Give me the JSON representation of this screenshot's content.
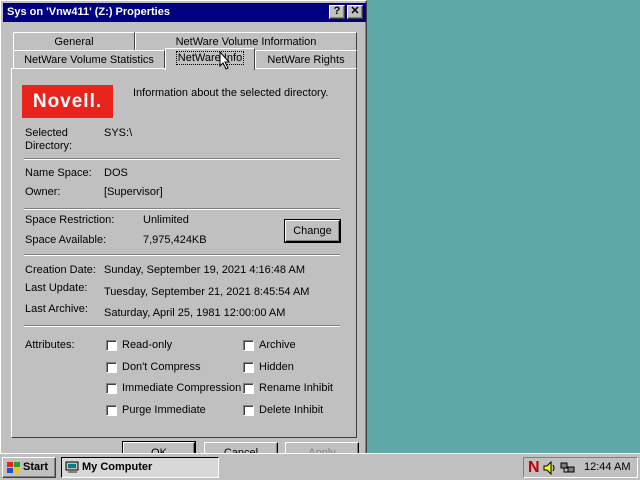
{
  "window": {
    "title": "Sys on 'Vnw411' (Z:) Properties",
    "help_btn": "?",
    "close_btn": "✕"
  },
  "tabs": {
    "row1": [
      "General",
      "NetWare Volume Information"
    ],
    "row2": [
      "NetWare Volume Statistics",
      "NetWare Info",
      "NetWare Rights"
    ],
    "active": "NetWare Info"
  },
  "info": {
    "logo": "Novell.",
    "description": "Information about the selected directory.",
    "selected_directory_label": "Selected Directory:",
    "selected_directory_value": "SYS:\\",
    "name_space_label": "Name Space:",
    "name_space_value": "DOS",
    "owner_label": "Owner:",
    "owner_value": "[Supervisor]",
    "space_restriction_label": "Space Restriction:",
    "space_restriction_value": "Unlimited",
    "space_available_label": "Space Available:",
    "space_available_value": "7,975,424KB",
    "change_button": "Change",
    "creation_date_label": "Creation Date:",
    "creation_date_value": "Sunday, September 19, 2021 4:16:48 AM",
    "last_update_label": "Last Update:",
    "last_update_value": "Tuesday, September 21, 2021 8:45:54 AM",
    "last_archive_label": "Last Archive:",
    "last_archive_value": "Saturday, April 25, 1981 12:00:00 AM",
    "attributes_label": "Attributes:",
    "attributes": [
      {
        "label": "Read-only",
        "checked": false
      },
      {
        "label": "Don't Compress",
        "checked": false
      },
      {
        "label": "Immediate Compression",
        "checked": false
      },
      {
        "label": "Purge Immediate",
        "checked": false
      },
      {
        "label": "Archive",
        "checked": false
      },
      {
        "label": "Hidden",
        "checked": false
      },
      {
        "label": "Rename Inhibit",
        "checked": false
      },
      {
        "label": "Delete Inhibit",
        "checked": false
      }
    ]
  },
  "buttons": {
    "ok": "OK",
    "cancel": "Cancel",
    "apply": "Apply"
  },
  "taskbar": {
    "start": "Start",
    "task": "My Computer",
    "clock": "12:44 AM"
  },
  "colors": {
    "desktop": "#5fa8a8",
    "titlebar": "#000080",
    "novell_red": "#e8231c"
  }
}
